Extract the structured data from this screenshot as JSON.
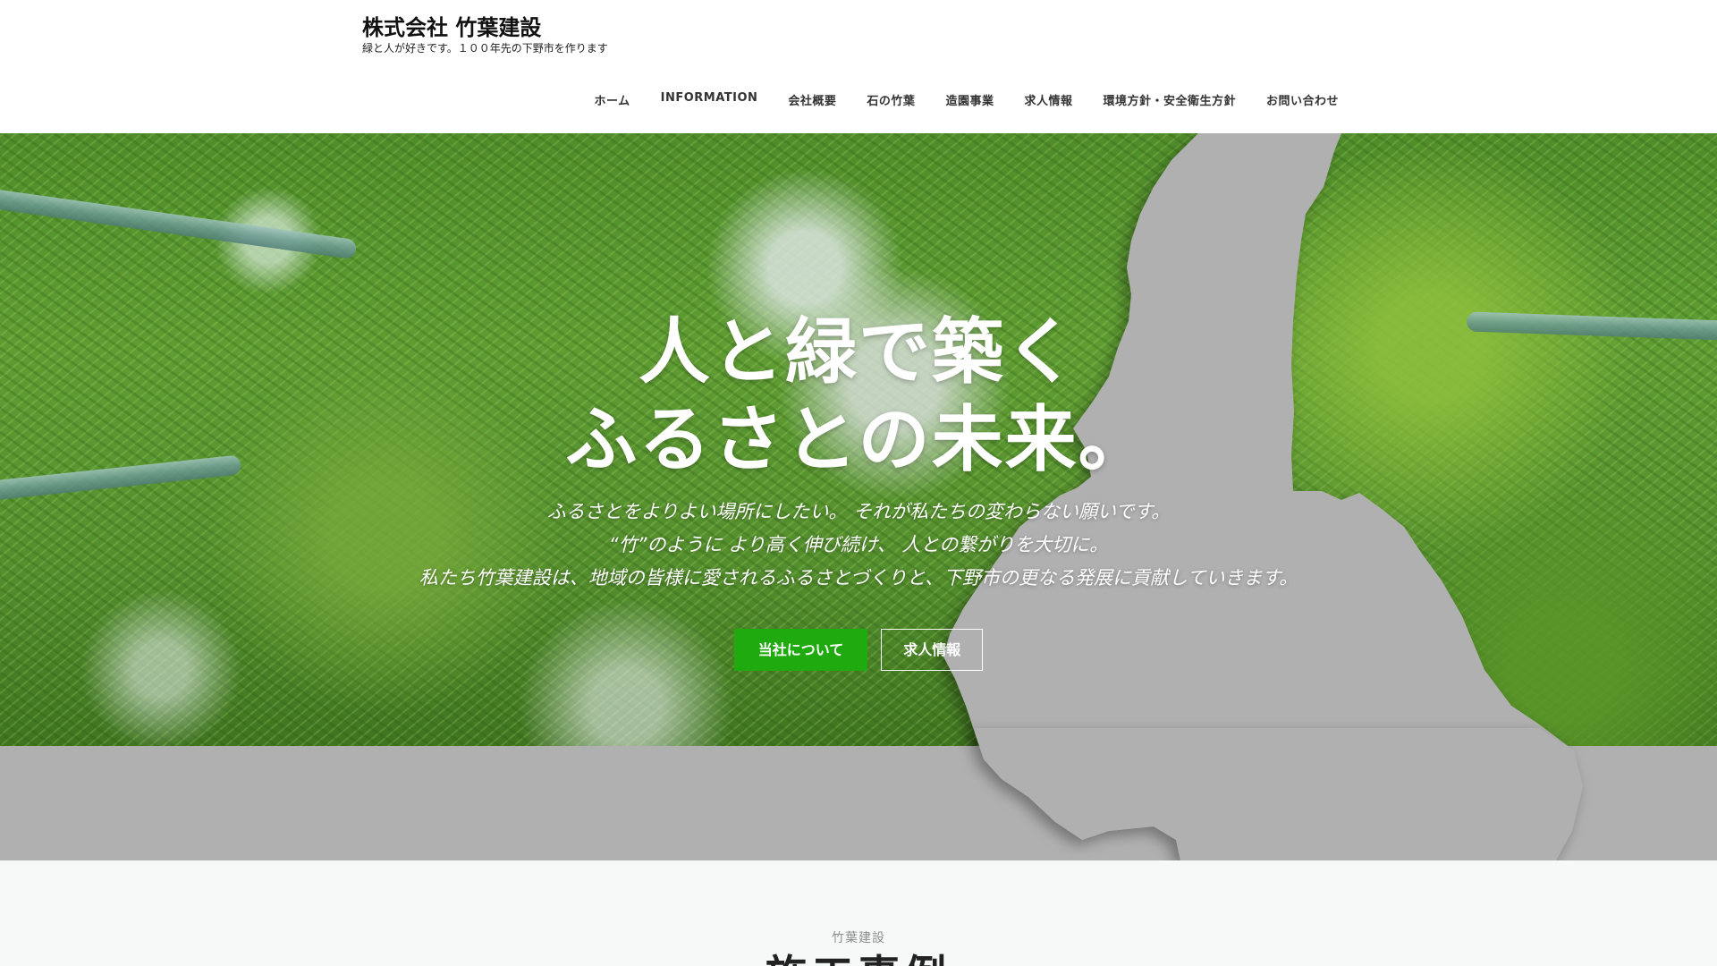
{
  "header": {
    "site_title": "株式会社 竹葉建設",
    "tagline": "緑と人が好きです。１００年先の下野市を作ります",
    "nav": [
      {
        "label": "ホーム"
      },
      {
        "label": "INFORMATION"
      },
      {
        "label": "会社概要"
      },
      {
        "label": "石の竹葉"
      },
      {
        "label": "造園事業"
      },
      {
        "label": "求人情報"
      },
      {
        "label": "環境方針・安全衛生方針"
      },
      {
        "label": "お問い合わせ"
      }
    ]
  },
  "hero": {
    "heading_line1": "人と緑で築く",
    "heading_line2": "ふるさとの未来。",
    "text_line1": "ふるさとをよりよい場所にしたい。 それが私たちの変わらない願いです。",
    "text_line2": "“竹”のように より高く伸び続け、 人との繋がりを大切に。",
    "text_line3": "私たち竹葉建設は、地域の皆様に愛されるふるさとづくりと、下野市の更なる発展に貢献していきます。",
    "primary_button": "当社について",
    "secondary_button": "求人情報"
  },
  "section": {
    "eyebrow": "竹葉建設",
    "heading": "施工事例"
  },
  "colors": {
    "accent_green": "#1faa0f",
    "map_gray": "#b0b0b0"
  }
}
